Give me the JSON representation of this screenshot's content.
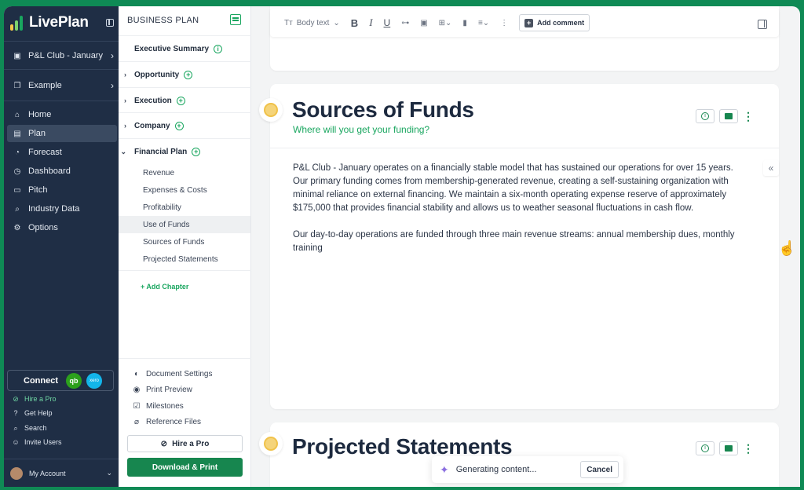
{
  "app": {
    "name": "LivePlan"
  },
  "nav": {
    "company": "P&L Club - January",
    "workspace": "Example",
    "items": [
      {
        "label": "Home",
        "icon": "home-icon"
      },
      {
        "label": "Plan",
        "icon": "plan-icon",
        "active": true
      },
      {
        "label": "Forecast",
        "icon": "forecast-icon"
      },
      {
        "label": "Dashboard",
        "icon": "dashboard-icon"
      },
      {
        "label": "Pitch",
        "icon": "pitch-icon"
      },
      {
        "label": "Industry Data",
        "icon": "industry-data-icon"
      },
      {
        "label": "Options",
        "icon": "gear-icon"
      }
    ],
    "connect": {
      "label": "Connect",
      "qb": "qb",
      "xero": "xero"
    },
    "links": [
      {
        "label": "Hire a Pro",
        "icon": "check-circle-icon"
      },
      {
        "label": "Get Help",
        "icon": "help-icon"
      },
      {
        "label": "Search",
        "icon": "search-icon"
      },
      {
        "label": "Invite Users",
        "icon": "invite-users-icon"
      }
    ],
    "account": "My Account"
  },
  "outline": {
    "header": "BUSINESS PLAN",
    "chapters": [
      {
        "label": "Executive Summary"
      },
      {
        "label": "Opportunity"
      },
      {
        "label": "Execution"
      },
      {
        "label": "Company"
      },
      {
        "label": "Financial Plan"
      }
    ],
    "subsections": [
      "Revenue",
      "Expenses & Costs",
      "Profitability",
      "Use of Funds",
      "Sources of Funds",
      "Projected Statements"
    ],
    "selected": "Use of Funds",
    "add_chapter": "+ Add Chapter",
    "tools": [
      "Document Settings",
      "Print Preview",
      "Milestones",
      "Reference Files"
    ],
    "hire_pro": "Hire a Pro",
    "download": "Download & Print"
  },
  "toolbar": {
    "text_style": "Body text",
    "add_comment": "Add comment"
  },
  "sections": {
    "sources": {
      "title": "Sources of Funds",
      "subtitle": "Where will you get your funding?",
      "paragraphs": [
        "P&L Club - January operates on a financially stable model that has sustained our operations for over 15 years. Our primary funding comes from membership-generated revenue, creating a self-sustaining organization with minimal reliance on external financing. We maintain a six-month operating expense reserve of approximately $175,000 that provides financial stability and allows us to weather seasonal fluctuations in cash flow.",
        "Our day-to-day operations are funded through three main revenue streams: annual membership dues, monthly training"
      ]
    },
    "projected": {
      "title": "Projected Statements"
    }
  },
  "toast": {
    "text": "Generating content...",
    "cancel": "Cancel"
  },
  "colors": {
    "brand_green": "#17864f",
    "accent_green": "#19a65f",
    "nav_bg": "#1f2e45",
    "frame_bg": "#0f8a55"
  }
}
